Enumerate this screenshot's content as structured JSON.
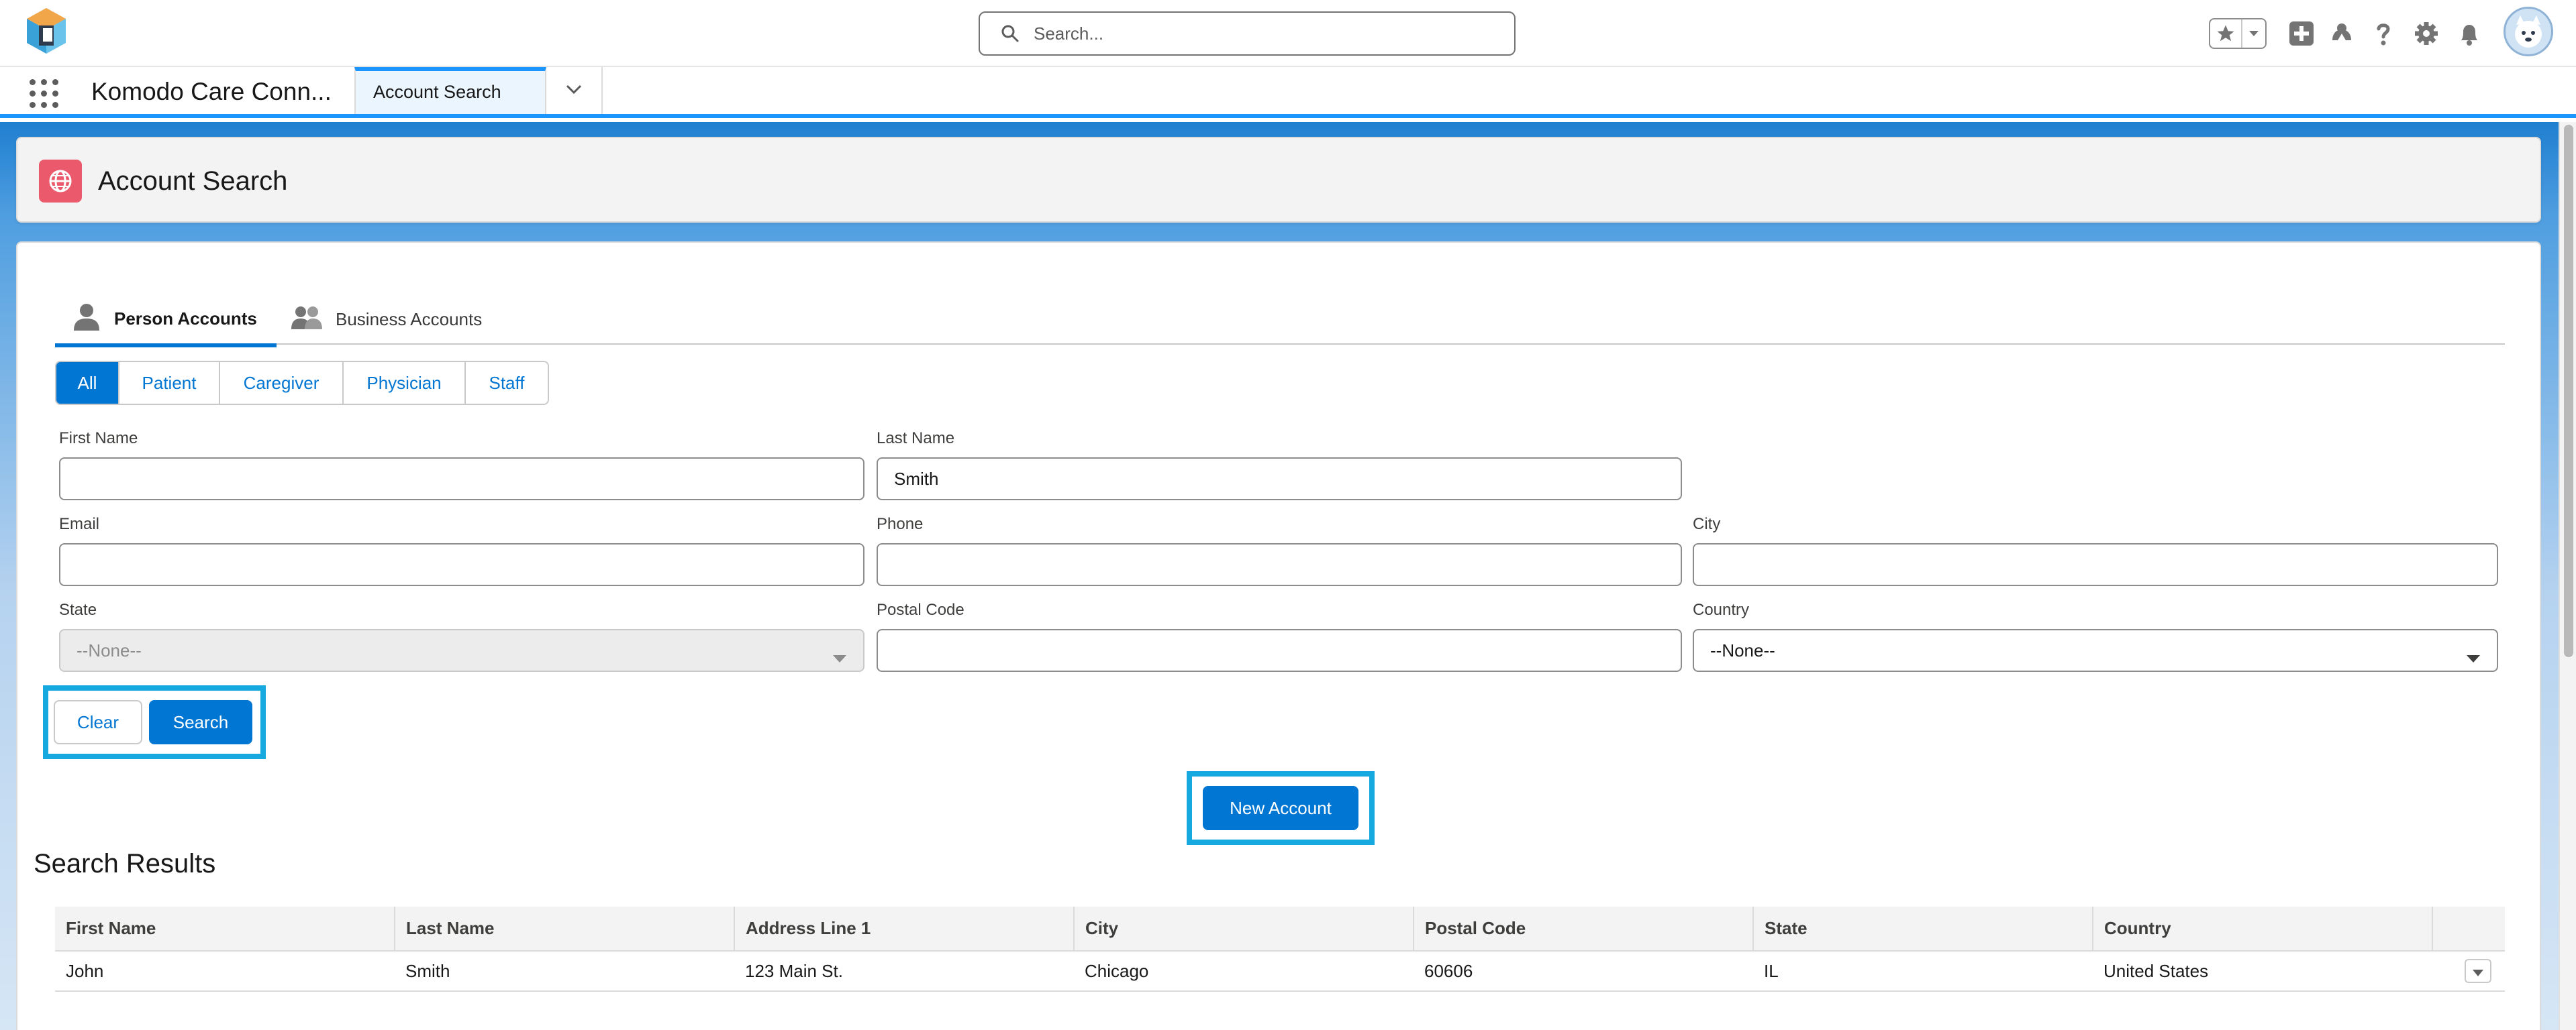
{
  "global_header": {
    "search_placeholder": "Search..."
  },
  "nav": {
    "app_name": "Komodo Care Conn...",
    "active_tab": "Account Search"
  },
  "page": {
    "title": "Account Search"
  },
  "tabs": [
    {
      "label": "Person Accounts",
      "active": true
    },
    {
      "label": "Business Accounts",
      "active": false
    }
  ],
  "filters": [
    {
      "label": "All",
      "active": true
    },
    {
      "label": "Patient",
      "active": false
    },
    {
      "label": "Caregiver",
      "active": false
    },
    {
      "label": "Physician",
      "active": false
    },
    {
      "label": "Staff",
      "active": false
    }
  ],
  "form": {
    "first_name": {
      "label": "First Name",
      "value": ""
    },
    "last_name": {
      "label": "Last Name",
      "value": "Smith"
    },
    "email": {
      "label": "Email",
      "value": ""
    },
    "phone": {
      "label": "Phone",
      "value": ""
    },
    "city": {
      "label": "City",
      "value": ""
    },
    "state": {
      "label": "State",
      "value": "--None--",
      "disabled": true
    },
    "postal_code": {
      "label": "Postal Code",
      "value": ""
    },
    "country": {
      "label": "Country",
      "value": "--None--"
    }
  },
  "buttons": {
    "clear": "Clear",
    "search": "Search",
    "new_account": "New Account"
  },
  "results": {
    "title": "Search Results",
    "columns": [
      "First Name",
      "Last Name",
      "Address Line 1",
      "City",
      "Postal Code",
      "State",
      "Country"
    ],
    "rows": [
      [
        "John",
        "Smith",
        "123 Main St.",
        "Chicago",
        "60606",
        "IL",
        "United States"
      ]
    ]
  },
  "colors": {
    "brand": "#0176d3",
    "highlight": "#16a9e0",
    "page_icon": "#ea5a6c"
  },
  "icons": [
    "app-logo-icon",
    "search-icon",
    "favorites-star-icon",
    "favorites-caret-icon",
    "add-icon",
    "trailhead-icon",
    "help-icon",
    "setup-gear-icon",
    "notifications-bell-icon",
    "user-avatar",
    "app-launcher-icon",
    "chevron-down-icon",
    "page-globe-icon",
    "person-icon",
    "group-icon",
    "row-action-caret-icon"
  ]
}
